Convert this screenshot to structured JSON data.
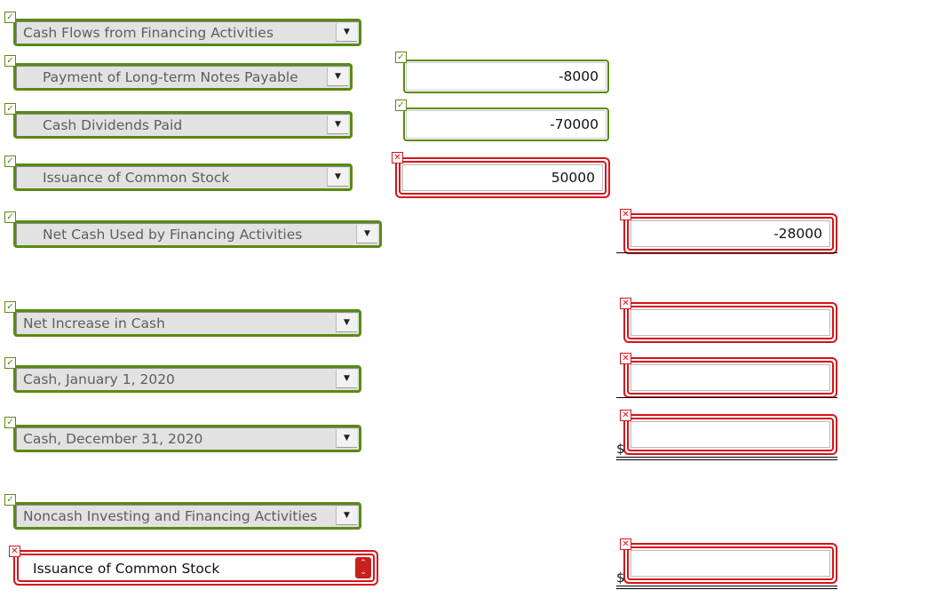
{
  "rows": [
    {
      "label": "Cash Flows from Financing Activities",
      "status": "correct"
    },
    {
      "label": "Payment of Long-term Notes Payable",
      "status": "correct",
      "amount": "-8000",
      "amount_status": "correct"
    },
    {
      "label": "Cash Dividends Paid",
      "status": "correct",
      "amount": "-70000",
      "amount_status": "correct"
    },
    {
      "label": "Issuance of Common Stock",
      "status": "correct",
      "amount": "50000",
      "amount_status": "incorrect"
    },
    {
      "label": "Net Cash Used by Financing Activities",
      "status": "correct",
      "total": "-28000",
      "total_status": "incorrect"
    },
    {
      "label": "Net Increase in Cash",
      "status": "correct",
      "total": "",
      "total_status": "incorrect"
    },
    {
      "label": "Cash, January 1, 2020",
      "status": "correct",
      "total": "",
      "total_status": "incorrect"
    },
    {
      "label": "Cash, December 31, 2020",
      "status": "correct",
      "total": "",
      "total_status": "incorrect",
      "currency": "$"
    },
    {
      "label": "Noncash Investing and Financing Activities",
      "status": "correct"
    },
    {
      "label": "Issuance of Common Stock",
      "status": "incorrect",
      "total": "",
      "total_status": "incorrect",
      "currency": "$"
    }
  ],
  "icons": {
    "correct": "✓",
    "incorrect": "✕",
    "dropdown": "▼",
    "spinner": "⌃⌄"
  },
  "colors": {
    "correct": "#5a8a14",
    "incorrect": "#d4141c"
  }
}
